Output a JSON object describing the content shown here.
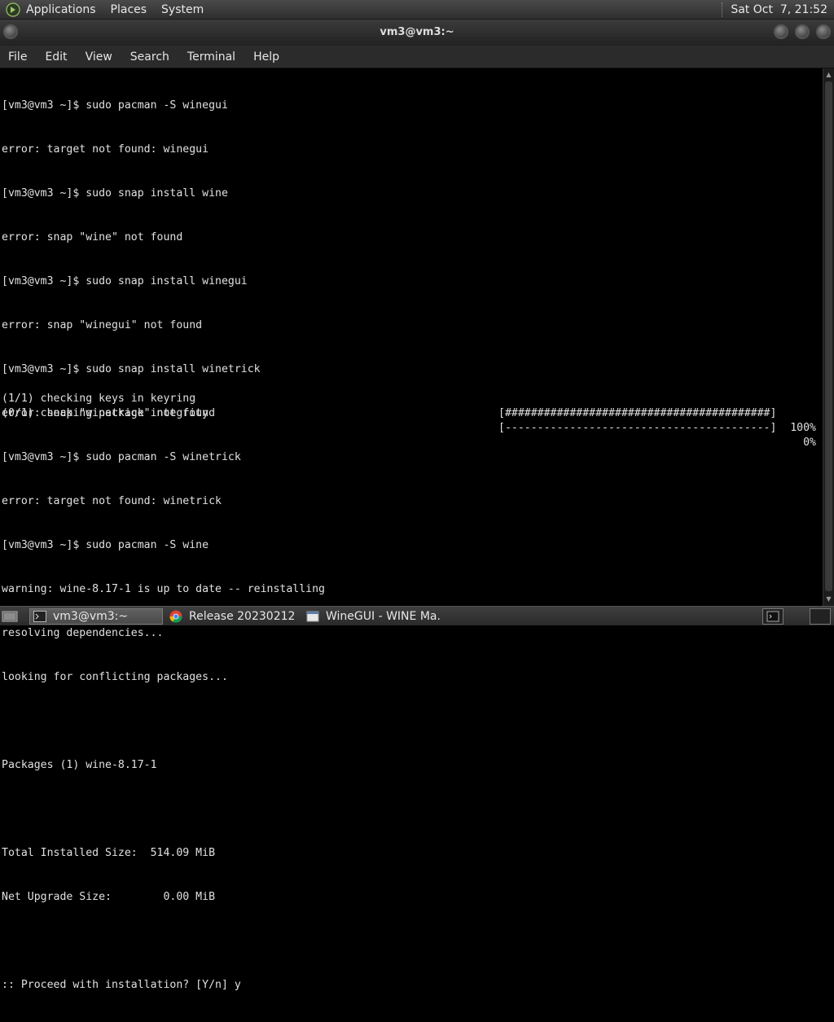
{
  "top_panel": {
    "menus": [
      "Applications",
      "Places",
      "System"
    ],
    "clock": "Sat Oct  7, 21:52"
  },
  "window": {
    "title": "vm3@vm3:~"
  },
  "menubar": [
    "File",
    "Edit",
    "View",
    "Search",
    "Terminal",
    "Help"
  ],
  "terminal": {
    "lines": [
      "[vm3@vm3 ~]$ sudo pacman -S winegui",
      "error: target not found: winegui",
      "[vm3@vm3 ~]$ sudo snap install wine",
      "error: snap \"wine\" not found",
      "[vm3@vm3 ~]$ sudo snap install winegui",
      "error: snap \"winegui\" not found",
      "[vm3@vm3 ~]$ sudo snap install winetrick",
      "error: snap \"winetrick\" not found",
      "[vm3@vm3 ~]$ sudo pacman -S winetrick",
      "error: target not found: winetrick",
      "[vm3@vm3 ~]$ sudo pacman -S wine",
      "warning: wine-8.17-1 is up to date -- reinstalling",
      "resolving dependencies...",
      "looking for conflicting packages...",
      "",
      "Packages (1) wine-8.17-1",
      "",
      "Total Installed Size:  514.09 MiB",
      "Net Upgrade Size:        0.00 MiB",
      "",
      ":: Proceed with installation? [Y/n] y"
    ],
    "progress": [
      {
        "label": "(1/1) checking keys in keyring",
        "bar": "[#########################################]",
        "percent": "100%"
      },
      {
        "label": "(0/1) checking package integrity",
        "bar": "[-----------------------------------------]",
        "percent": "0%"
      }
    ]
  },
  "taskbar": {
    "items": [
      {
        "label": "vm3@vm3:~",
        "icon": "terminal-icon",
        "active": true
      },
      {
        "label": "Release 20230212 · ...",
        "icon": "chrome-icon",
        "active": false
      },
      {
        "label": "WineGUI - WINE Ma...",
        "icon": "window-icon",
        "active": false
      }
    ]
  },
  "colors": {
    "terminal_bg": "#000000",
    "terminal_fg": "#e0e0e0",
    "panel_bg": "#3a3a3a"
  }
}
